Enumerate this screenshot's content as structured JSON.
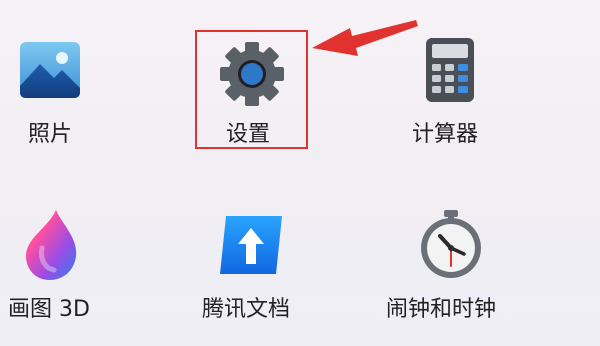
{
  "apps": [
    {
      "label": "照片",
      "icon": "photos-icon"
    },
    {
      "label": "设置",
      "icon": "settings-gear-icon"
    },
    {
      "label": "计算器",
      "icon": "calculator-icon"
    },
    {
      "label": "画图 3D",
      "icon": "paint-3d-icon"
    },
    {
      "label": "腾讯文档",
      "icon": "tencent-docs-icon"
    },
    {
      "label": "闹钟和时钟",
      "icon": "alarms-clock-icon"
    }
  ],
  "colors": {
    "highlight": "#e0332f",
    "arrow": "#e0332f",
    "gear": "#5a6068",
    "gear_center": "#2f78c8"
  }
}
